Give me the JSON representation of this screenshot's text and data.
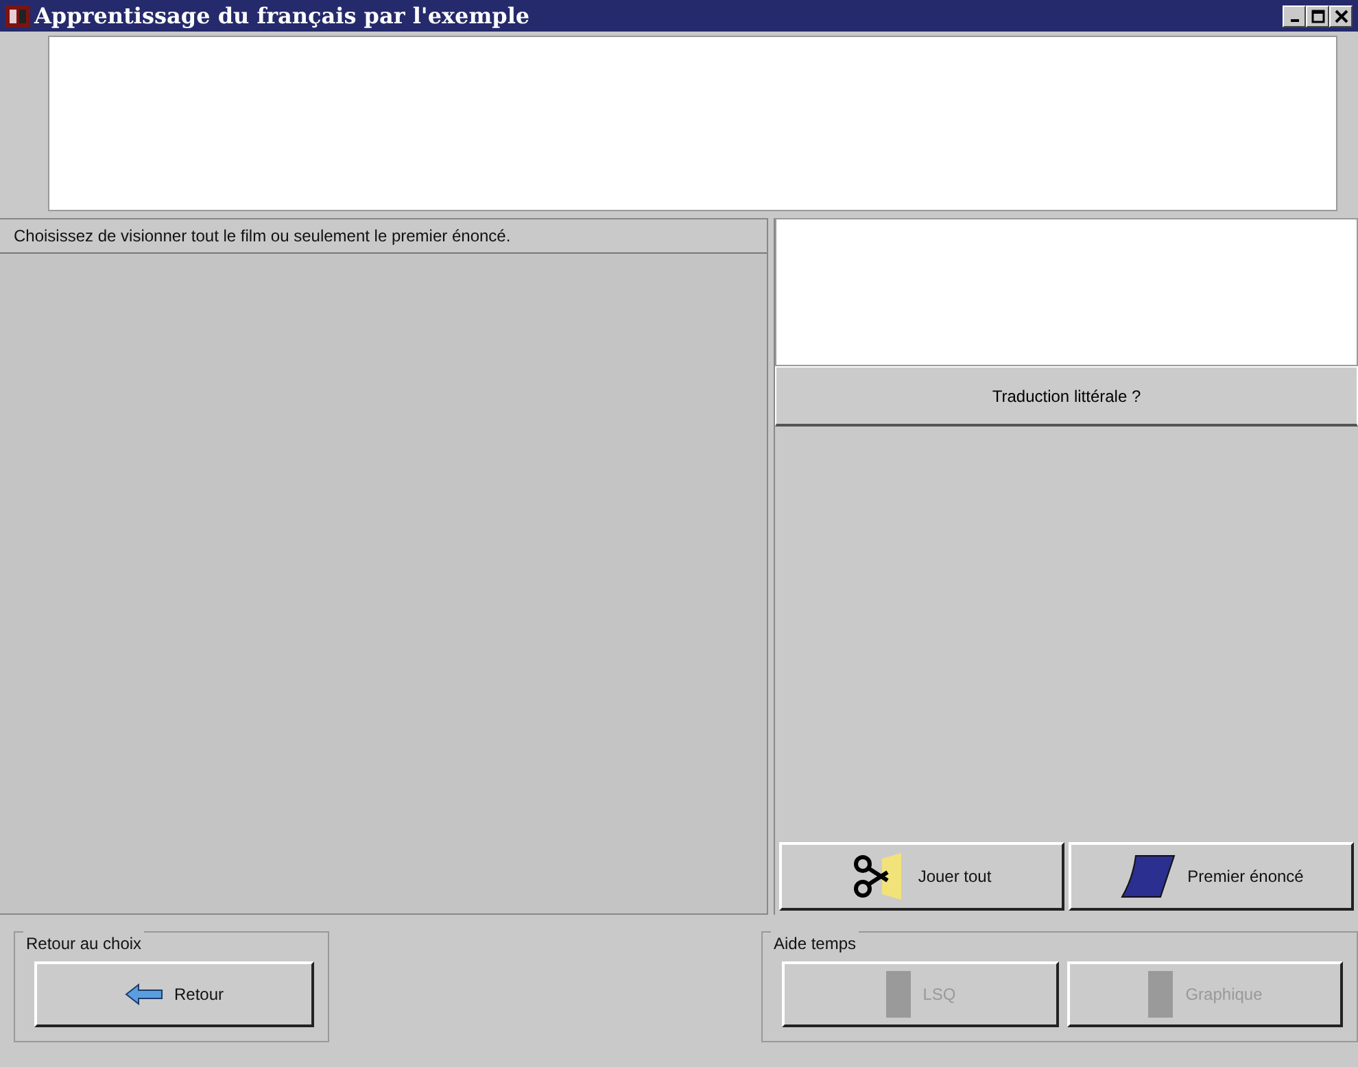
{
  "window": {
    "title": "Apprentissage du français par l'exemple"
  },
  "instruction": "Choisissez de visionner tout le film ou seulement le premier énoncé.",
  "translation_button": {
    "label": "Traduction littérale ?"
  },
  "play_buttons": [
    {
      "label": "Jouer tout",
      "disabled": false
    },
    {
      "label": "Premier énoncé",
      "disabled": false
    }
  ],
  "groups": [
    {
      "title": "Retour au choix",
      "buttons": [
        {
          "label": "Retour",
          "disabled": false
        }
      ]
    },
    {
      "title": "Aide temps",
      "buttons": [
        {
          "label": "LSQ",
          "disabled": true
        },
        {
          "label": "Graphique",
          "disabled": true
        }
      ]
    }
  ]
}
